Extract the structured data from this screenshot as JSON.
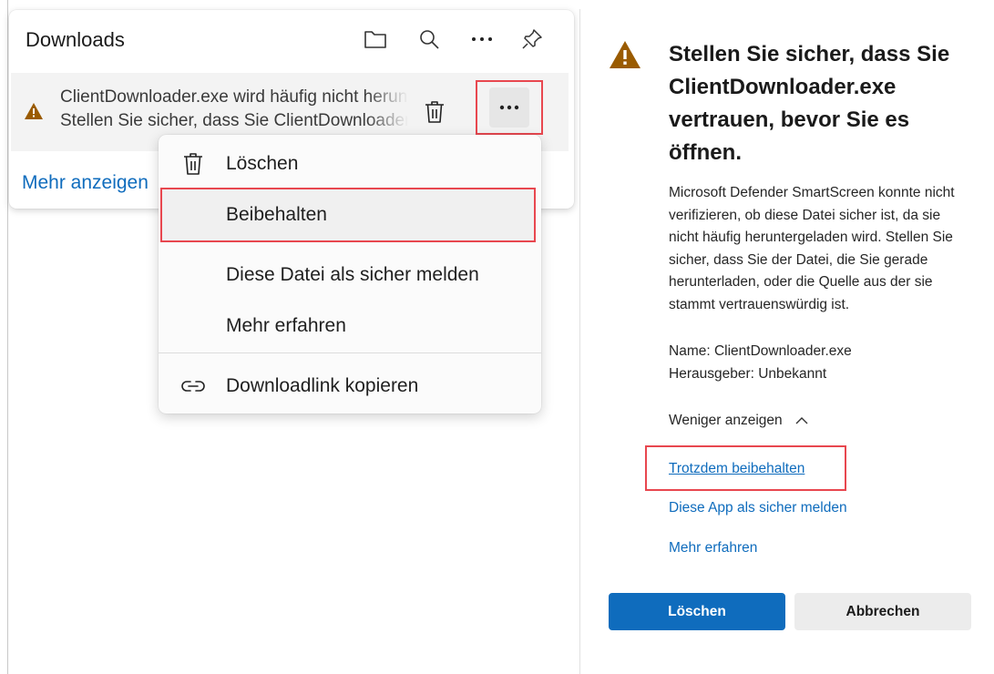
{
  "flyout": {
    "title": "Downloads",
    "item": {
      "line1": "ClientDownloader.exe wird häufig nicht heruntergeladen.",
      "line2": "Stellen Sie sicher, dass Sie ClientDownloader.exe vertrauen."
    },
    "more_link": "Mehr anzeigen",
    "header_icons": [
      "folder-icon",
      "search-icon",
      "more-icon",
      "pin-icon"
    ]
  },
  "menu": {
    "items": [
      {
        "label": "Löschen",
        "icon": "trash-icon"
      },
      {
        "label": "Beibehalten"
      },
      {
        "label": "Diese Datei als sicher melden"
      },
      {
        "label": "Mehr erfahren"
      },
      {
        "label": "Downloadlink kopieren",
        "icon": "link-icon"
      }
    ]
  },
  "panel": {
    "title": "Stellen Sie sicher, dass Sie ClientDownloader.exe vertrauen, bevor Sie es öffnen.",
    "body": "Microsoft Defender SmartScreen konnte nicht verifizieren, ob diese Datei sicher ist, da sie nicht häufig heruntergeladen wird. Stellen Sie sicher, dass Sie der Datei, die Sie gerade herunterladen, oder die Quelle aus der sie stammt vertrauenswürdig ist.",
    "name": "Name: ClientDownloader.exe",
    "publisher": "Herausgeber: Unbekannt",
    "show_less": "Weniger anzeigen",
    "keep_anyway": "Trotzdem beibehalten",
    "report_safe": "Diese App als sicher melden",
    "learn_more": "Mehr erfahren",
    "delete_button": "Löschen",
    "cancel_button": "Abbrechen"
  },
  "colors": {
    "accent": "#0f6cbd",
    "highlight_border": "#e8474f",
    "warning": "#9a5b00"
  }
}
